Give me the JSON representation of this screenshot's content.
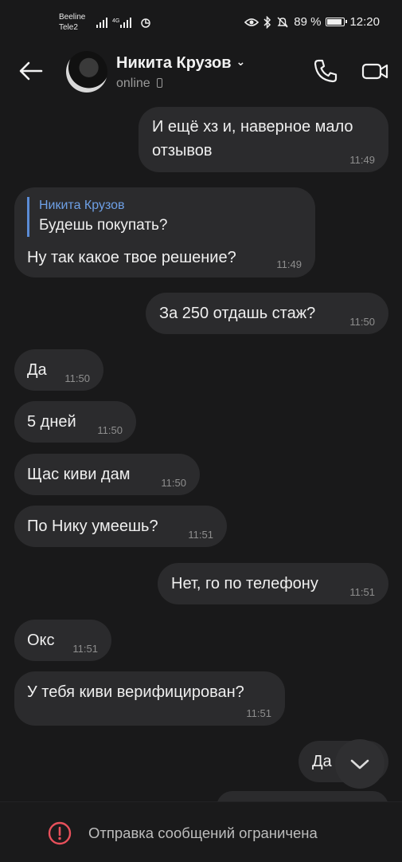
{
  "status": {
    "carrier1": "Beeline",
    "carrier2": "Tele2",
    "net_type": "4G",
    "battery_percent": "89 %",
    "battery_level": 0.89,
    "time": "12:20"
  },
  "header": {
    "contact_name": "Никита Крузов",
    "presence": "online"
  },
  "messages": [
    {
      "side": "out",
      "text_line1": "И ещё хз и, наверное мало",
      "text_line2": "отзывов",
      "time": "11:49"
    },
    {
      "side": "in",
      "reply_name": "Никита Крузов",
      "reply_text": "Будешь покупать?",
      "text": "Ну так какое твое решение?",
      "time": "11:49"
    },
    {
      "side": "out",
      "text": "За 250 отдашь стаж?",
      "time": "11:50"
    },
    {
      "side": "in",
      "text": "Да",
      "time": "11:50"
    },
    {
      "side": "in",
      "text": "5 дней",
      "time": "11:50"
    },
    {
      "side": "in",
      "text": "Щас киви дам",
      "time": "11:50"
    },
    {
      "side": "in",
      "text": "По Нику умеешь?",
      "time": "11:51"
    },
    {
      "side": "out",
      "text": "Нет, го по телефону",
      "time": "11:51"
    },
    {
      "side": "in",
      "text": "Окс",
      "time": "11:51"
    },
    {
      "side": "in",
      "text": "У тебя киви верифицирован?",
      "time": "11:51"
    },
    {
      "side": "out",
      "text": "Да",
      "time": ""
    }
  ],
  "footer": {
    "notice": "Отправка сообщений ограничена"
  },
  "colors": {
    "background": "#19191a",
    "bubble": "#2b2b2d",
    "reply_accent": "#6ea0e6",
    "warning": "#e8505b"
  }
}
